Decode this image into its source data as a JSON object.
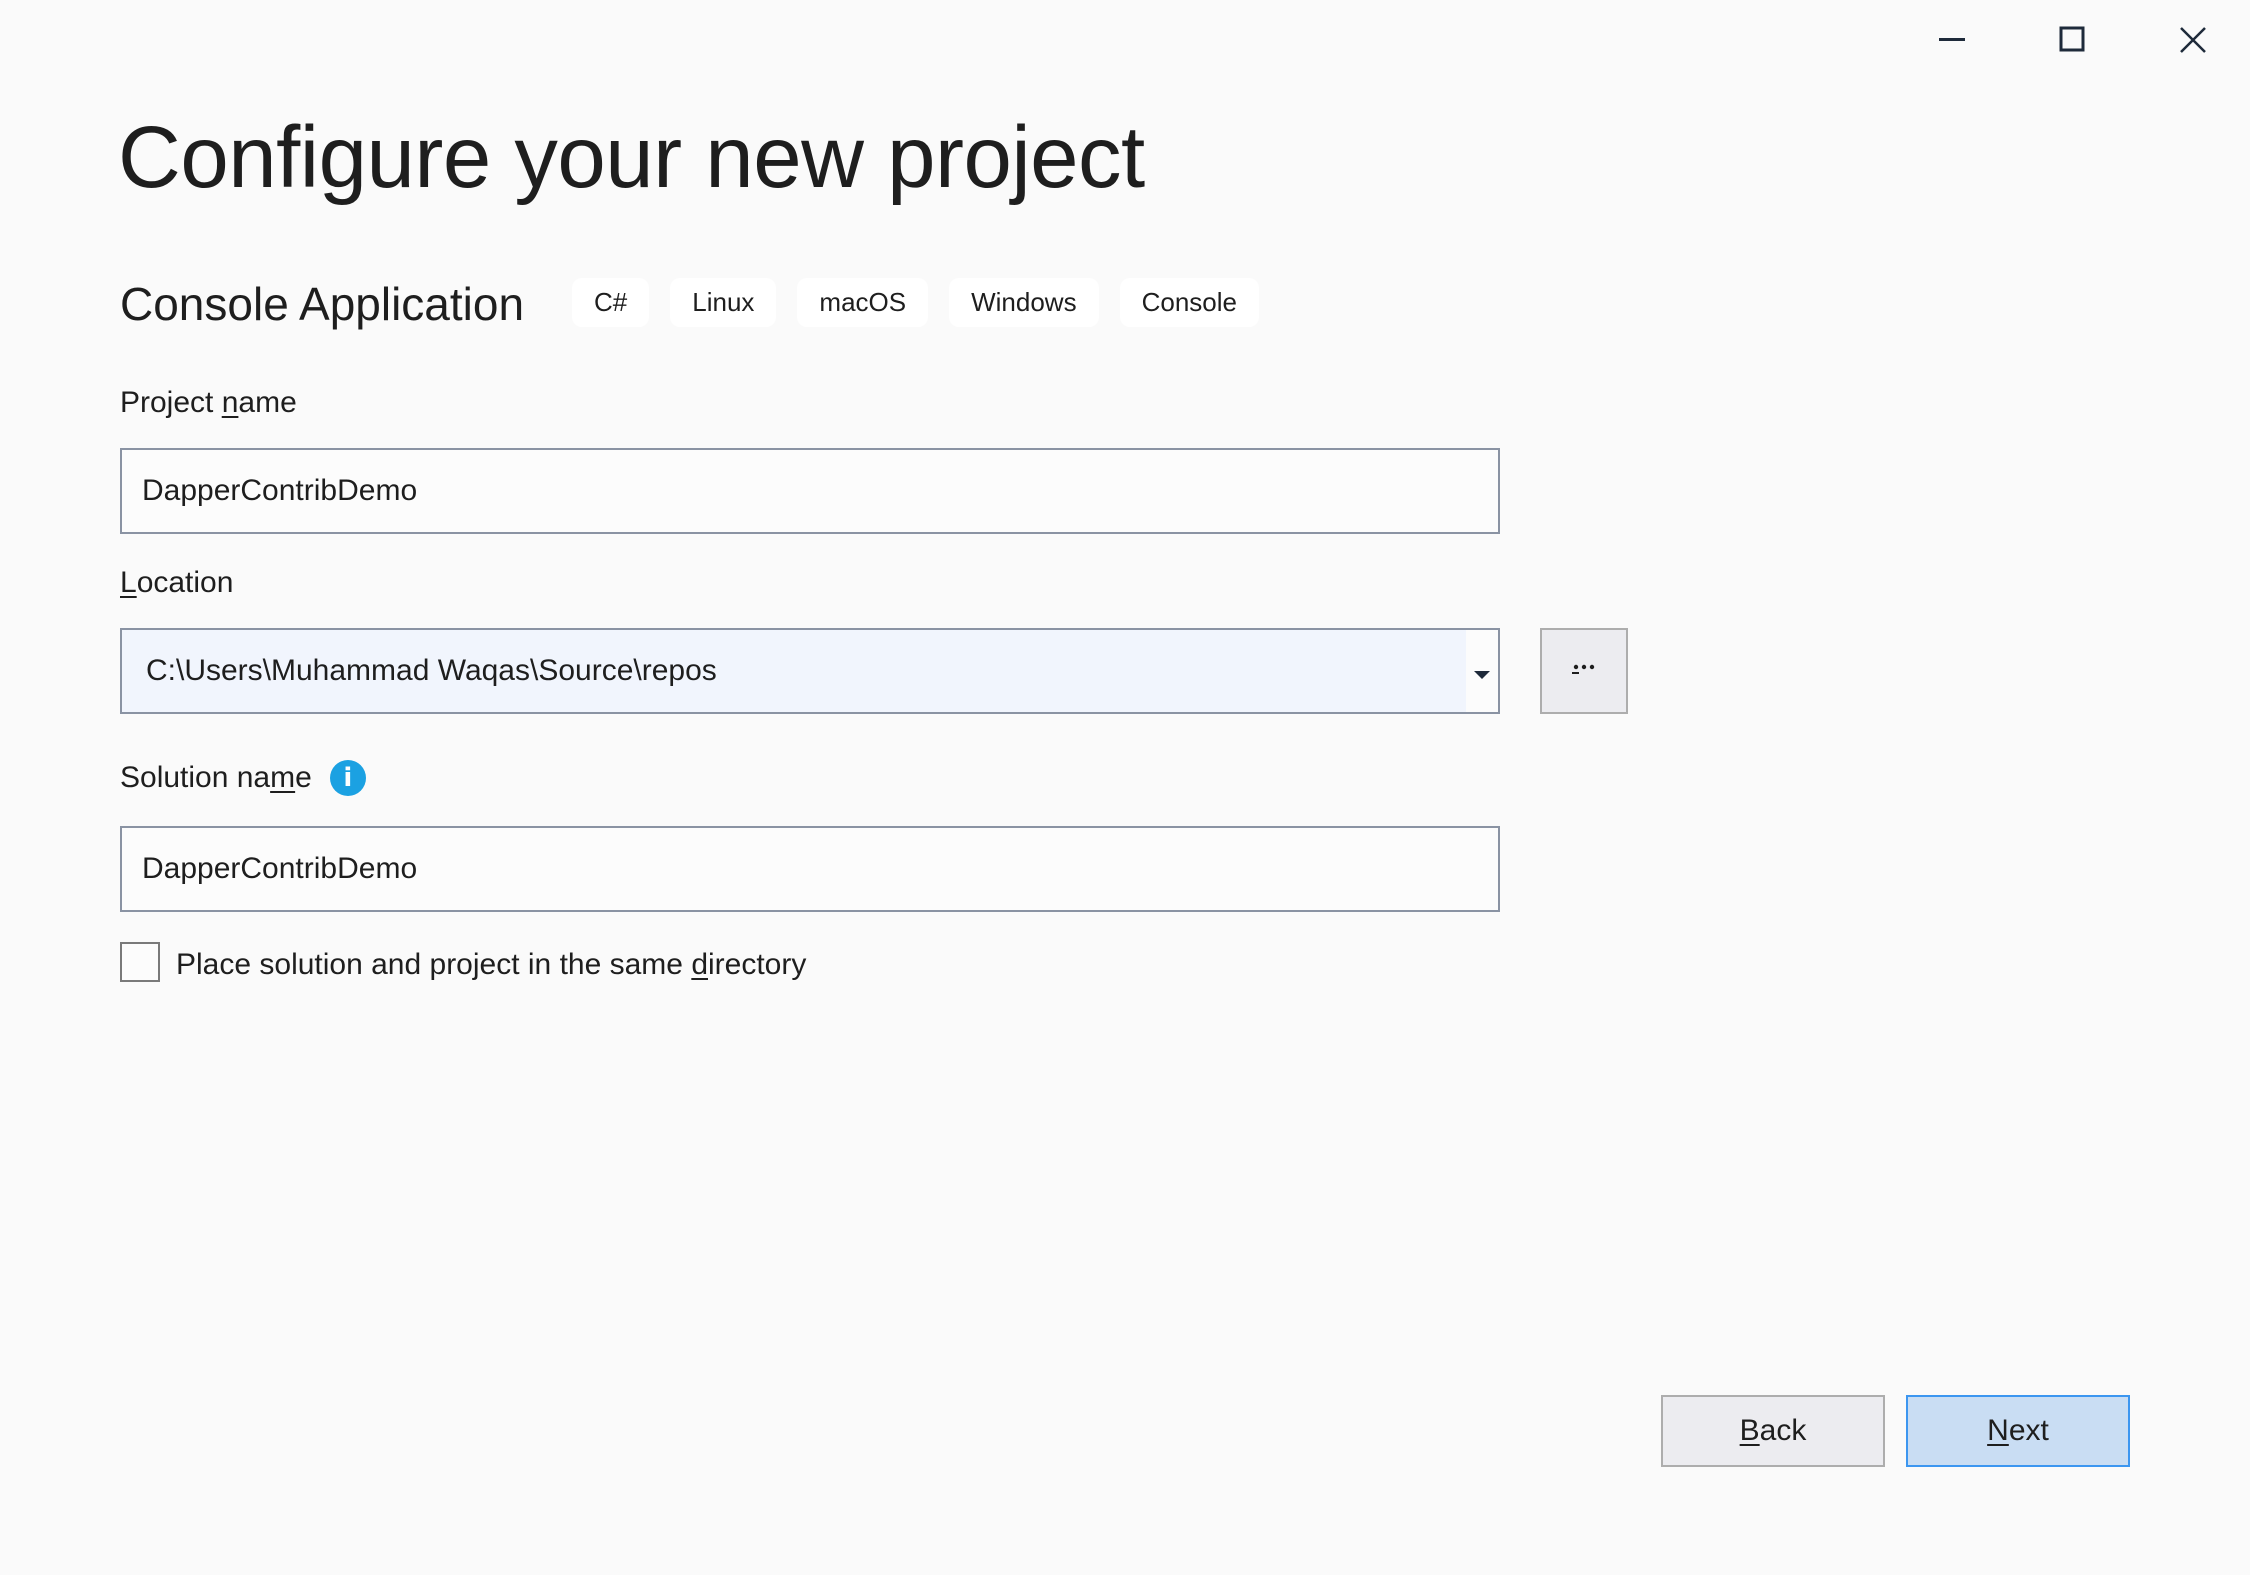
{
  "window": {
    "controls": {
      "minimize_icon": "minimize-icon",
      "maximize_icon": "maximize-icon",
      "close_icon": "close-icon"
    }
  },
  "header": {
    "title": "Configure your new project",
    "template_name": "Console Application",
    "tags": [
      "C#",
      "Linux",
      "macOS",
      "Windows",
      "Console"
    ]
  },
  "form": {
    "project_name": {
      "label_pre": "Project ",
      "label_access": "n",
      "label_post": "ame",
      "value": "DapperContribDemo"
    },
    "location": {
      "label_pre": "",
      "label_access": "L",
      "label_post": "ocation",
      "value": "C:\\Users\\Muhammad Waqas\\Source\\repos",
      "browse_label": "..."
    },
    "solution_name": {
      "label_pre": "Solution na",
      "label_access": "m",
      "label_post": "e",
      "info_icon": "info-icon",
      "value": "DapperContribDemo"
    },
    "same_directory": {
      "label_pre": "Place solution and project in the same ",
      "label_access": "d",
      "label_post": "irectory",
      "checked": false
    }
  },
  "footer": {
    "back": {
      "access": "B",
      "rest": "ack"
    },
    "next": {
      "access": "N",
      "rest": "ext"
    }
  },
  "colors": {
    "background": "#fafafa",
    "info": "#1ba1e2",
    "primary_button_bg": "#c9ddf3",
    "primary_button_border": "#3c96f0"
  }
}
